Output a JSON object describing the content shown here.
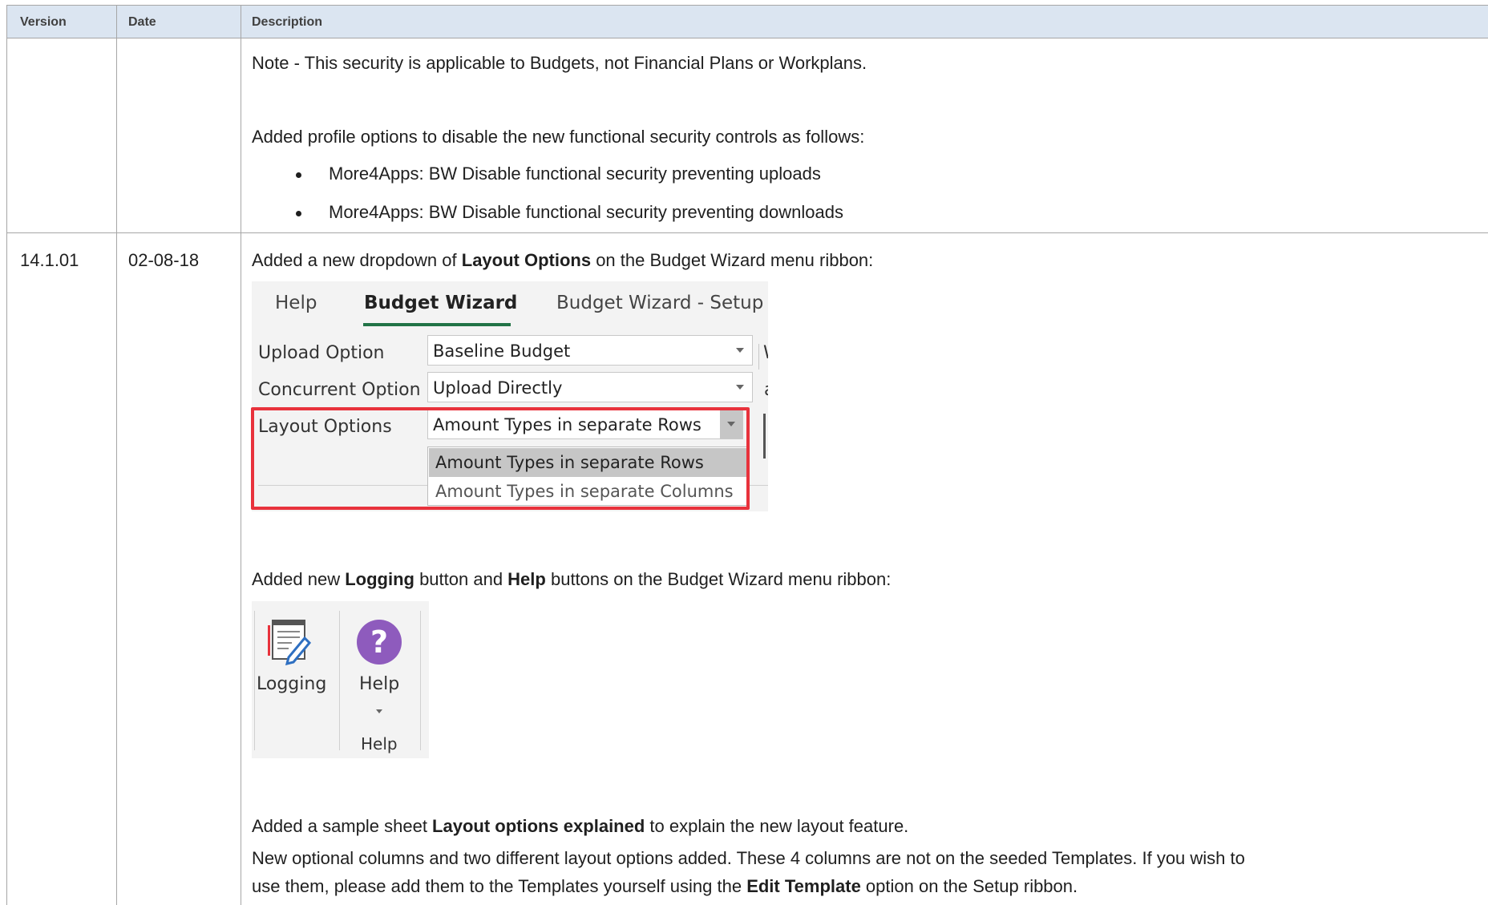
{
  "table": {
    "headers": {
      "version": "Version",
      "date": "Date",
      "description": "Description"
    }
  },
  "row_prev": {
    "note": "Note - This security is applicable to Budgets, not Financial Plans or Workplans.",
    "profile_intro": "Added profile options to disable the new functional security controls as follows:",
    "bullets": [
      "More4Apps: BW Disable functional security preventing uploads",
      "More4Apps: BW Disable functional security preventing downloads"
    ]
  },
  "row_14101": {
    "version": "14.1.01",
    "date": "02-08-18",
    "line1_pre": "Added a new dropdown of ",
    "line1_bold": "Layout Options",
    "line1_post": " on the Budget Wizard menu ribbon:",
    "line2_pre": "Added new ",
    "line2_bold1": "Logging",
    "line2_mid": " button and ",
    "line2_bold2": "Help",
    "line2_post": " buttons on the Budget Wizard menu ribbon:",
    "line3_pre": "Added a sample sheet ",
    "line3_bold": "Layout options explained",
    "line3_post": " to explain the new layout feature.",
    "line4": "New optional columns and two different layout options added. These 4 columns are not on the seeded Templates. If you wish to",
    "line5_pre": "use them, please add them to the Templates yourself using the ",
    "line5_bold": "Edit Template",
    "line5_post": " option on the Setup ribbon."
  },
  "ribbon1": {
    "tabs": [
      "Help",
      "Budget Wizard",
      "Budget Wizard - Setup"
    ],
    "active_tab": "Budget Wizard",
    "fields": [
      {
        "label": "Upload Option",
        "value": "Baseline Budget"
      },
      {
        "label": "Concurrent Option",
        "value": "Upload Directly"
      },
      {
        "label": "Layout Options",
        "value": "Amount Types in separate Rows"
      }
    ],
    "dropdown_options": [
      "Amount Types in separate Rows",
      "Amount Types in separate Columns"
    ],
    "selected_option": "Amount Types in separate Rows",
    "clipped_glyph_top": "W",
    "clipped_glyph_mid": "a",
    "highlight_color": "#e8323c",
    "accent_color": "#217346"
  },
  "ribbon2": {
    "logging_label": "Logging",
    "help_label": "Help",
    "group_label": "Help",
    "help_icon_color": "#8e5bbd"
  }
}
